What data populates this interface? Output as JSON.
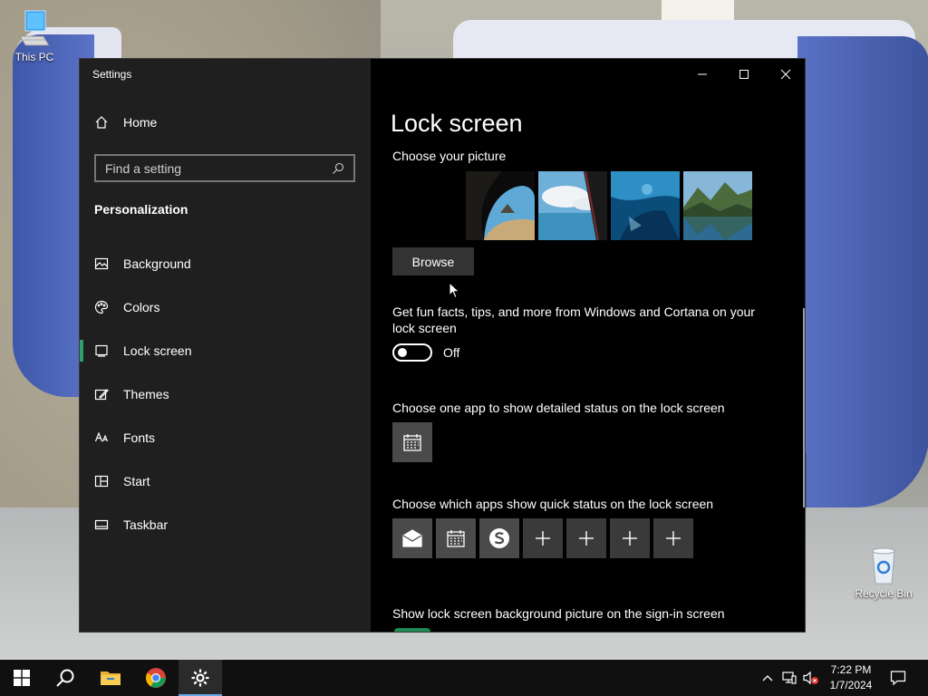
{
  "desktop": {
    "icons": [
      {
        "label": "This PC",
        "icon": "computer-icon"
      },
      {
        "label": "Recycle Bin",
        "icon": "recycle-bin-icon"
      }
    ]
  },
  "window": {
    "title": "Settings",
    "controls": [
      "minimize-icon",
      "maximize-icon",
      "close-icon"
    ]
  },
  "sidebar": {
    "home_label": "Home",
    "search_placeholder": "Find a setting",
    "section_title": "Personalization",
    "items": [
      {
        "label": "Background",
        "icon": "picture-icon"
      },
      {
        "label": "Colors",
        "icon": "palette-icon"
      },
      {
        "label": "Lock screen",
        "icon": "lock-screen-icon",
        "active": true
      },
      {
        "label": "Themes",
        "icon": "themes-icon"
      },
      {
        "label": "Fonts",
        "icon": "fonts-icon"
      },
      {
        "label": "Start",
        "icon": "start-icon"
      },
      {
        "label": "Taskbar",
        "icon": "taskbar-icon"
      }
    ]
  },
  "main": {
    "title": "Lock screen",
    "choose_picture_label": "Choose your picture",
    "browse_label": "Browse",
    "fun_facts_label": "Get fun facts, tips, and more from Windows and Cortana on your lock screen",
    "toggle_state": "Off",
    "detailed_status_label": "Choose one app to show detailed status on the lock screen",
    "quick_status_label": "Choose which apps show quick status on the lock screen",
    "signin_bg_label": "Show lock screen background picture on the sign-in screen",
    "quick_status_apps": [
      "mail-icon",
      "calendar-icon",
      "skype-icon",
      "add-icon",
      "add-icon",
      "add-icon",
      "add-icon"
    ]
  },
  "taskbar": {
    "time": "7:22 PM",
    "date": "1/7/2024"
  },
  "colors": {
    "accent": "#2f9e6a",
    "sidebar_bg": "#1f1f1f",
    "main_bg": "#000000",
    "taskbar_bg": "#101010"
  }
}
